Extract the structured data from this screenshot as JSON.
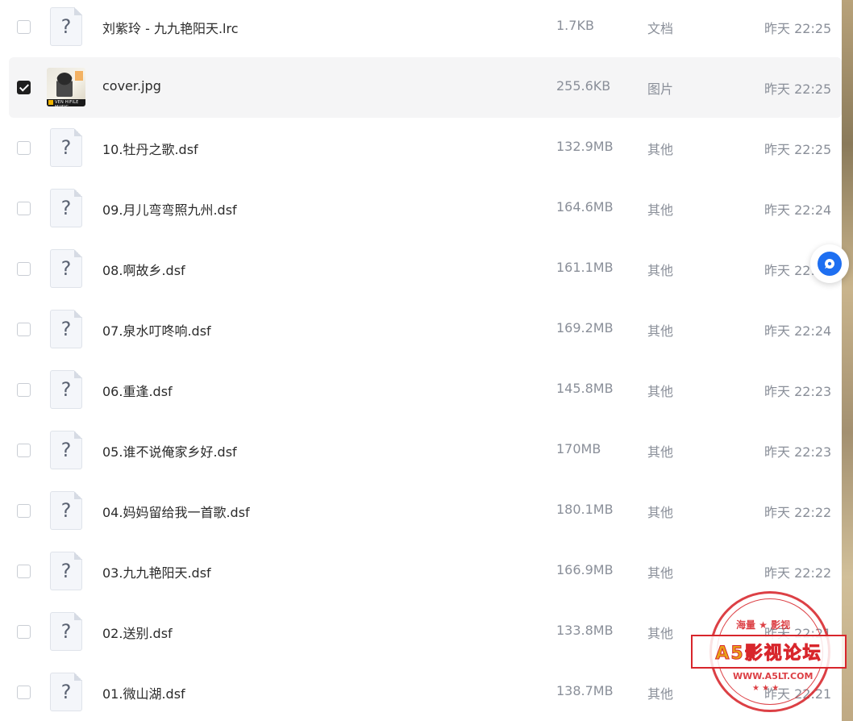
{
  "files": [
    {
      "name": "刘紫玲 - 九九艳阳天.lrc",
      "size": "1.7KB",
      "type": "文档",
      "time": "昨天 22:25",
      "checked": false,
      "icon": "unknown-file-icon"
    },
    {
      "name": "cover.jpg",
      "size": "255.6KB",
      "type": "图片",
      "time": "昨天 22:25",
      "checked": true,
      "icon": "image-thumbnail"
    },
    {
      "name": "10.牡丹之歌.dsf",
      "size": "132.9MB",
      "type": "其他",
      "time": "昨天 22:25",
      "checked": false,
      "icon": "unknown-file-icon"
    },
    {
      "name": "09.月儿弯弯照九州.dsf",
      "size": "164.6MB",
      "type": "其他",
      "time": "昨天 22:24",
      "checked": false,
      "icon": "unknown-file-icon"
    },
    {
      "name": "08.啊故乡.dsf",
      "size": "161.1MB",
      "type": "其他",
      "time": "昨天 22:24",
      "checked": false,
      "icon": "unknown-file-icon"
    },
    {
      "name": "07.泉水叮咚响.dsf",
      "size": "169.2MB",
      "type": "其他",
      "time": "昨天 22:24",
      "checked": false,
      "icon": "unknown-file-icon"
    },
    {
      "name": "06.重逢.dsf",
      "size": "145.8MB",
      "type": "其他",
      "time": "昨天 22:23",
      "checked": false,
      "icon": "unknown-file-icon"
    },
    {
      "name": "05.谁不说俺家乡好.dsf",
      "size": "170MB",
      "type": "其他",
      "time": "昨天 22:23",
      "checked": false,
      "icon": "unknown-file-icon"
    },
    {
      "name": "04.妈妈留给我一首歌.dsf",
      "size": "180.1MB",
      "type": "其他",
      "time": "昨天 22:22",
      "checked": false,
      "icon": "unknown-file-icon"
    },
    {
      "name": "03.九九艳阳天.dsf",
      "size": "166.9MB",
      "type": "其他",
      "time": "昨天 22:22",
      "checked": false,
      "icon": "unknown-file-icon"
    },
    {
      "name": "02.送别.dsf",
      "size": "133.8MB",
      "type": "其他",
      "time": "昨天 22:21",
      "checked": false,
      "icon": "unknown-file-icon"
    },
    {
      "name": "01.微山湖.dsf",
      "size": "138.7MB",
      "type": "其他",
      "time": "昨天 22:21",
      "checked": false,
      "icon": "unknown-file-icon"
    }
  ],
  "thumb_band_text": "VEN HIFILE MUSIC",
  "float_button": {
    "icon": "chat-bubble-icon",
    "color": "#1e6ff1"
  },
  "watermark": {
    "top_text": "海量 ★ 影视",
    "banner_text": "A5影视论坛",
    "url": "WWW.A5LT.COM",
    "stars": "★ ★ ★",
    "color": "#d8262c"
  },
  "colors": {
    "selected_row_bg": "#f5f5f6",
    "checkbox_checked": "#1f1f1f",
    "muted_text": "#8a8f99"
  }
}
